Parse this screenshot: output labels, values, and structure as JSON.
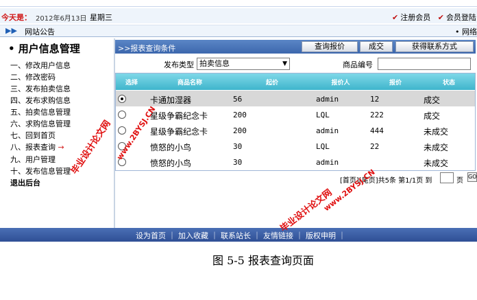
{
  "topbar": {
    "today_label": "今天是：",
    "date": "2012年6月13日",
    "weekday": "星期三",
    "register_label": "注册会员",
    "member_login_label": "会员登陆"
  },
  "notice": {
    "label": "网站公告",
    "right_text": "• 网络"
  },
  "sidebar": {
    "title": "• 用户信息管理",
    "items": [
      {
        "label": "一、修改用户信息"
      },
      {
        "label": "二、修改密码"
      },
      {
        "label": "三、发布拍卖信息"
      },
      {
        "label": "四、发布求购信息"
      },
      {
        "label": "五、拍卖信息管理"
      },
      {
        "label": "六、求购信息管理"
      },
      {
        "label": "七、回到首页"
      },
      {
        "label": "八、报表查询",
        "arrow": "→"
      },
      {
        "label": "九、用户管理"
      },
      {
        "label": "十、发布信息管理"
      }
    ],
    "logout": "退出后台"
  },
  "query": {
    "title": ">>报表查询条件",
    "buttons": [
      "查询报价",
      "成交",
      "获得联系方式"
    ],
    "type_label": "发布类型",
    "type_value": "拍卖信息",
    "product_label": "商品编号",
    "product_value": ""
  },
  "table": {
    "headers": [
      "选择",
      "商品名称",
      "起价",
      "报价人",
      "报价",
      "状态"
    ],
    "rows": [
      {
        "selected": true,
        "name": "卡通加湿器",
        "start": "56",
        "bidder": "admin",
        "bid": "12",
        "status": "成交"
      },
      {
        "selected": false,
        "name": "星级争霸纪念卡",
        "start": "200",
        "bidder": "LQL",
        "bid": "222",
        "status": "成交"
      },
      {
        "selected": false,
        "name": "星级争霸纪念卡",
        "start": "200",
        "bidder": "admin",
        "bid": "444",
        "status": "未成交"
      },
      {
        "selected": false,
        "name": "愤怒的小鸟",
        "start": "30",
        "bidder": "LQL",
        "bid": "22",
        "status": "未成交"
      },
      {
        "selected": false,
        "name": "愤怒的小鸟",
        "start": "30",
        "bidder": "admin",
        "bid": "",
        "status": "未成交"
      }
    ]
  },
  "pager": {
    "text": "[首页][尾页]共5条 第1/1页 到",
    "page_unit": "页",
    "go": "GO"
  },
  "footer": {
    "links": [
      "设为首页",
      "加入收藏",
      "联系站长",
      "友情链接",
      "版权申明"
    ]
  },
  "caption": "图 5-5 报表查询页面",
  "watermarks": {
    "wm1": "毕业设计论文网",
    "wm2": "www.2BYSJ.CN",
    "wm3": "毕业设计论文网",
    "wm4": "www.2BYSJ.CN"
  },
  "colors": {
    "header_blue": "#3c67ad",
    "table_header": "#3fb5cc",
    "footer_blue": "#2f4f95",
    "watermark_red": "#e01010",
    "accent_red": "#d01818"
  }
}
